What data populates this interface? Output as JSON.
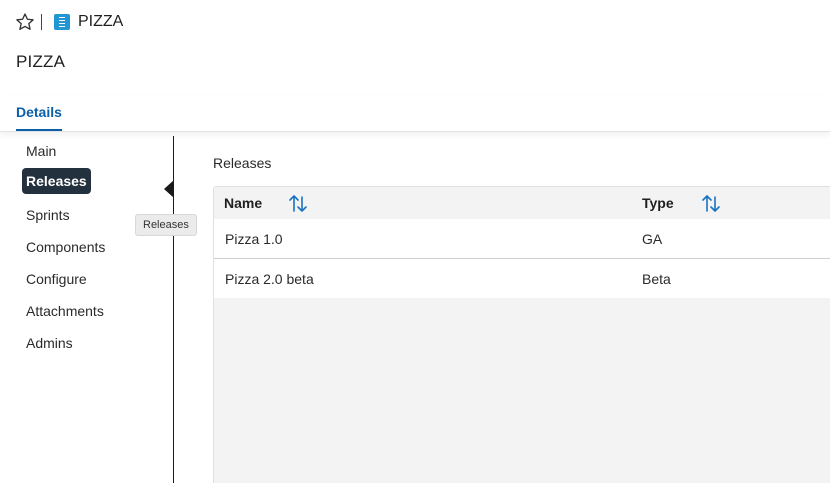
{
  "header": {
    "breadcrumb_title": "PIZZA",
    "page_title": "PIZZA"
  },
  "tabs": [
    {
      "label": "Details",
      "active": true
    }
  ],
  "sidebar": {
    "items": [
      {
        "label": "Main"
      },
      {
        "label": "Releases",
        "active": true
      },
      {
        "label": "Sprints"
      },
      {
        "label": "Components"
      },
      {
        "label": "Configure"
      },
      {
        "label": "Attachments"
      },
      {
        "label": "Admins"
      }
    ],
    "tooltip": "Releases"
  },
  "main": {
    "section_label": "Releases",
    "table": {
      "columns": [
        "Name",
        "Type"
      ],
      "rows": [
        [
          "Pizza 1.0",
          "GA"
        ],
        [
          "Pizza 2.0 beta",
          "Beta"
        ]
      ]
    }
  },
  "colors": {
    "accent": "#0a5fa8",
    "active_nav_bg": "#23303e",
    "app_icon": "#2196d3"
  },
  "icons": {
    "favorite": "star-icon",
    "app": "document-icon",
    "sort": "sort-arrows-icon"
  }
}
